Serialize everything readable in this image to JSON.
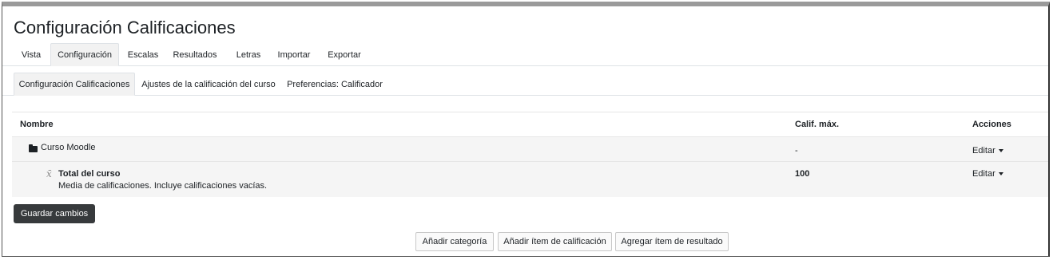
{
  "page": {
    "title": "Configuración Calificaciones"
  },
  "primary_tabs": [
    {
      "label": "Vista"
    },
    {
      "label": "Configuración",
      "active": true
    },
    {
      "label": "Escalas"
    },
    {
      "label": "Resultados"
    },
    {
      "label": "Letras"
    },
    {
      "label": "Importar"
    },
    {
      "label": "Exportar"
    }
  ],
  "secondary_tabs": [
    {
      "label": "Configuración Calificaciones",
      "active": true
    },
    {
      "label": "Ajustes de la calificación del curso"
    },
    {
      "label": "Preferencias: Calificador"
    }
  ],
  "table": {
    "headers": {
      "name": "Nombre",
      "max_grade": "Calif. máx.",
      "actions": "Acciones"
    },
    "rows": [
      {
        "icon": "folder-icon",
        "name": "Curso Moodle",
        "max_grade": "-",
        "action": "Editar"
      },
      {
        "icon": "mean-icon",
        "name": "Total del curso",
        "description": "Media de calificaciones. Incluye calificaciones vacías.",
        "max_grade": "100",
        "action": "Editar"
      }
    ]
  },
  "buttons": {
    "save": "Guardar cambios",
    "add_category": "Añadir categoría",
    "add_grade_item": "Añadir ítem de calificación",
    "add_outcome_item": "Agregar ítem de resultado"
  },
  "colors": {
    "primary_button": "#373a3c",
    "row_background": "#f5f5f5",
    "active_tab_background": "#f2f2f2"
  }
}
